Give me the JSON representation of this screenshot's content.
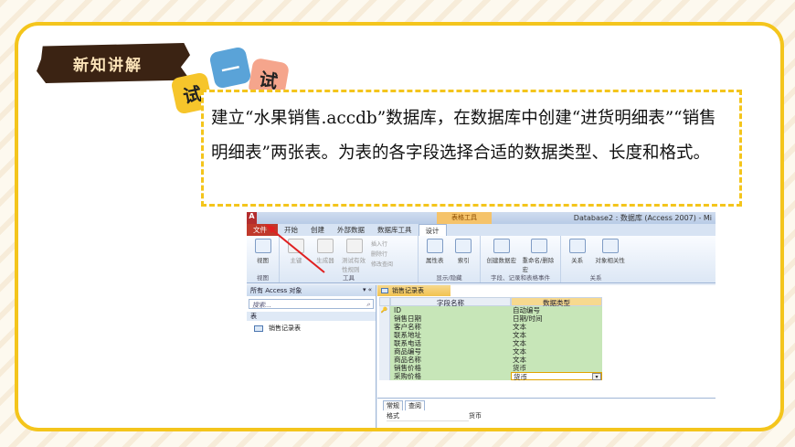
{
  "heading_tag": "新知讲解",
  "badges": [
    "试",
    "一",
    "试"
  ],
  "instruction": "建立“水果销售.accdb”数据库，在数据库中创建“进货明细表”“销售明细表”两张表。为表的各字段选择合适的数据类型、长度和格式。",
  "access": {
    "app_letter": "A",
    "contextual_tab": "表格工具",
    "window_title": "Database2 : 数据库 (Access 2007) - Mi",
    "tabs": [
      "文件",
      "开始",
      "创建",
      "外部数据",
      "数据库工具",
      "设计"
    ],
    "active_tab": "设计",
    "ribbon": {
      "view_group": {
        "label": "视图",
        "buttons": [
          "视图"
        ]
      },
      "tools_group": {
        "label": "工具",
        "buttons": [
          "主键",
          "生成器",
          "测试有效性规则"
        ],
        "small": [
          "插入行",
          "删除行",
          "修改查阅"
        ]
      },
      "show_group": {
        "label": "显示/隐藏",
        "buttons": [
          "属性表",
          "索引"
        ]
      },
      "events_group": {
        "label": "字段、记录和表格事件",
        "buttons": [
          "创建数据宏",
          "重命名/删除宏"
        ]
      },
      "rel_group": {
        "label": "关系",
        "buttons": [
          "关系",
          "对象相关性"
        ]
      }
    },
    "nav": {
      "header": "所有 Access 对象",
      "search_placeholder": "搜索...",
      "group": "表",
      "items": [
        "销售记录表"
      ]
    },
    "document_tab": "销售记录表",
    "columns": [
      "字段名称",
      "数据类型"
    ],
    "fields": [
      {
        "name": "ID",
        "type": "自动编号",
        "key": true
      },
      {
        "name": "销售日期",
        "type": "日期/时间"
      },
      {
        "name": "客户名称",
        "type": "文本"
      },
      {
        "name": "联系地址",
        "type": "文本"
      },
      {
        "name": "联系电话",
        "type": "文本"
      },
      {
        "name": "商品编号",
        "type": "文本"
      },
      {
        "name": "商品名称",
        "type": "文本"
      },
      {
        "name": "销售价格",
        "type": "货币"
      },
      {
        "name": "采购价格",
        "type": "货币"
      }
    ],
    "property_tabs": [
      "常规",
      "查阅"
    ],
    "properties": [
      {
        "key": "格式",
        "value": "货币"
      }
    ]
  },
  "colors": {
    "frame": "#f4c51c",
    "tag_bg": "#3b2313",
    "field_bg": "#c7e6b8"
  }
}
